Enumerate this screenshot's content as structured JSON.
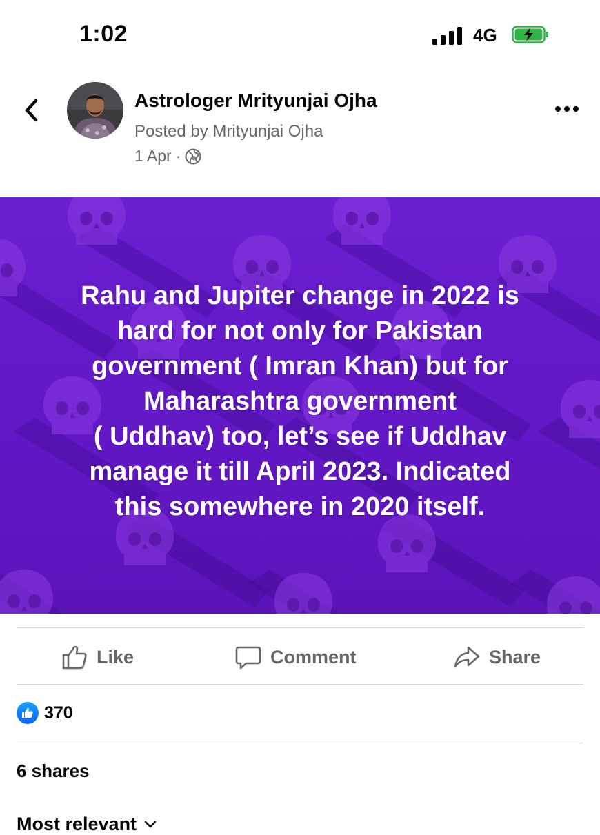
{
  "status_bar": {
    "time": "1:02",
    "network": "4G",
    "icons": [
      "signal-icon",
      "battery-charging-icon"
    ]
  },
  "post": {
    "page_name": "Astrologer Mrityunjai Ojha",
    "posted_by": "Posted by Mrityunjai Ojha",
    "date": "1 Apr",
    "separator": "·",
    "privacy_icon": "globe-icon",
    "image_text": "Rahu and Jupiter change in 2022 is\nhard for not only for Pakistan\ngovernment ( Imran Khan) but for\nMaharashtra government\n( Uddhav) too, let’s see if Uddhav\nmanage it till April 2023. Indicated\nthis somewhere in 2020 itself.",
    "image_background_color": "#6318c6"
  },
  "actions": {
    "like": "Like",
    "comment": "Comment",
    "share": "Share"
  },
  "engagement": {
    "reaction_count": "370",
    "shares": "6 shares"
  },
  "comments": {
    "sort_label": "Most relevant"
  },
  "colors": {
    "secondary_text": "#65676b",
    "like_blue": "#0866ff"
  }
}
